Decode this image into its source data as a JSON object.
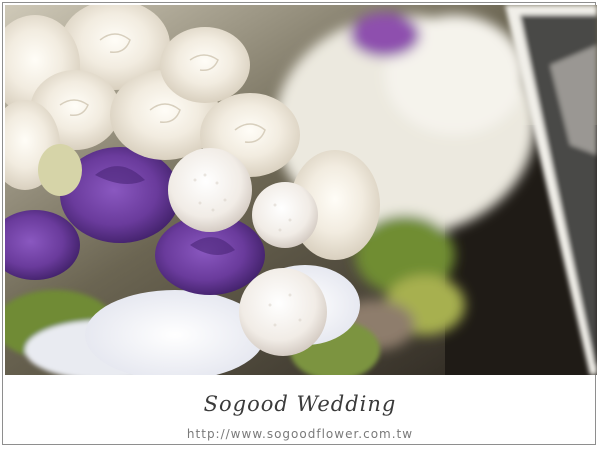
{
  "photo": {
    "subject": "bouquet-of-white-roses-and-purple-lisianthus",
    "colors": {
      "background_dark": "#2b2a24",
      "rose_white": "#f4efe4",
      "lisianthus_purple": "#6a3b9c",
      "leaf_green": "#6f8b34"
    }
  },
  "caption": {
    "brand": "Sogood Wedding",
    "url": "http://www.sogoodflower.com.tw"
  }
}
